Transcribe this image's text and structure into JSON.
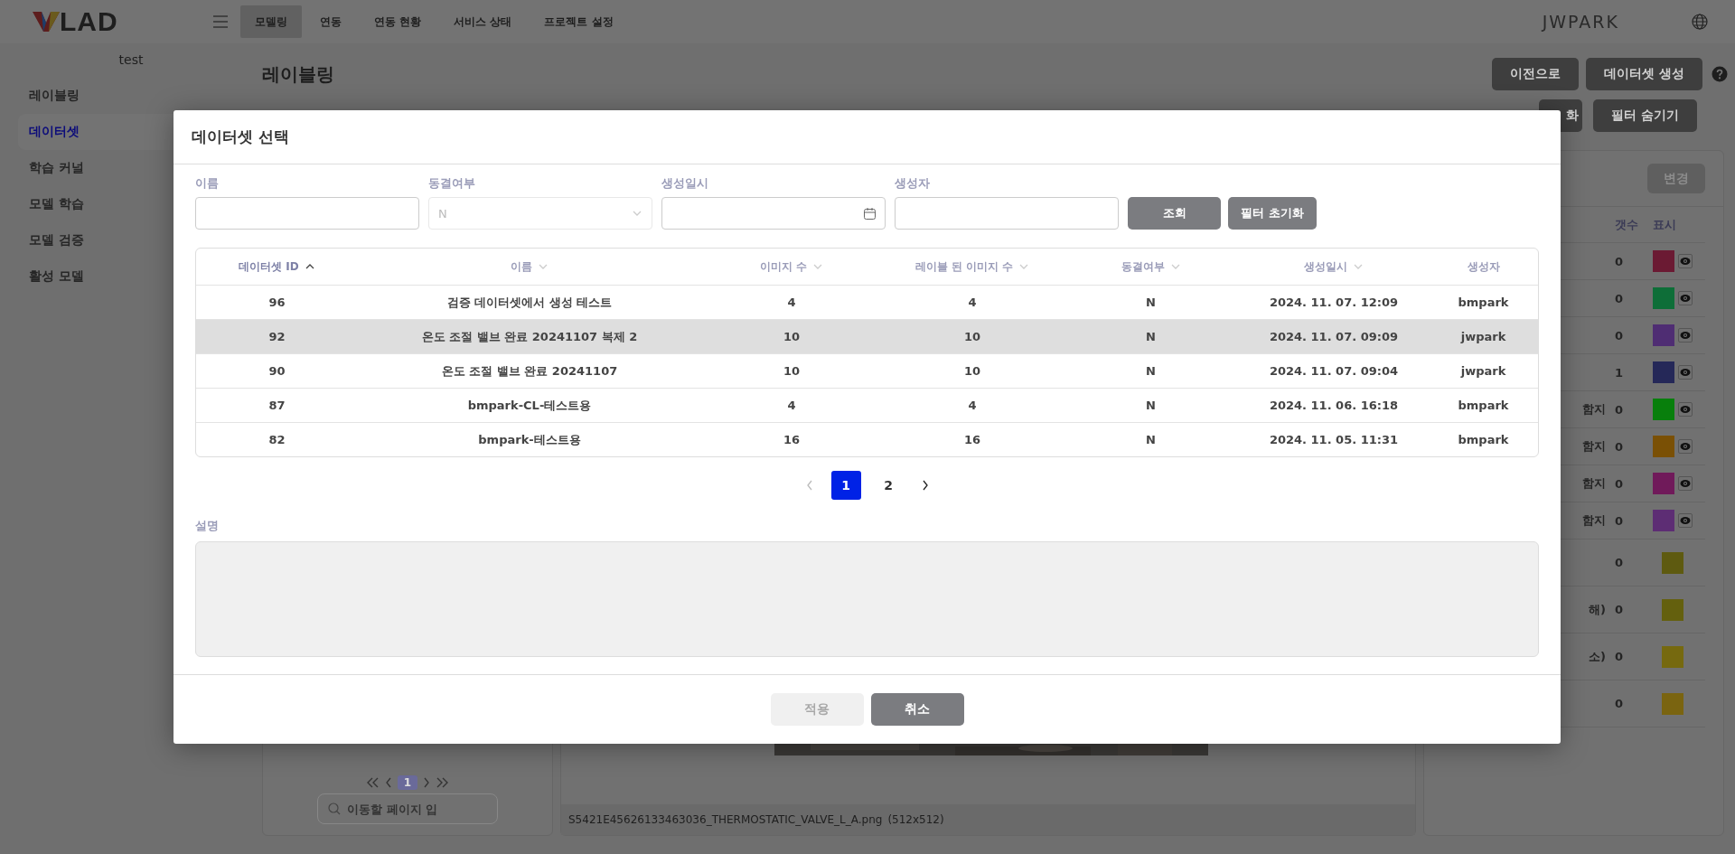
{
  "header": {
    "logo_text": "LAD",
    "nav": [
      {
        "label": "모델링",
        "selected": true
      },
      {
        "label": "연동",
        "selected": false
      },
      {
        "label": "연동 현황",
        "selected": false
      },
      {
        "label": "서비스 상태",
        "selected": false
      },
      {
        "label": "프로젝트 설정",
        "selected": false
      }
    ],
    "user": "JWPARK"
  },
  "sidebar": {
    "project": "test",
    "items": [
      {
        "label": "레이블링",
        "selected": false
      },
      {
        "label": "데이터셋",
        "selected": true
      },
      {
        "label": "학습 커널",
        "selected": false
      },
      {
        "label": "모델 학습",
        "selected": false
      },
      {
        "label": "모델 검증",
        "selected": false
      },
      {
        "label": "활성 모델",
        "selected": false
      }
    ]
  },
  "page": {
    "title": "레이블링",
    "actions": [
      "이전으로",
      "데이터셋 생성"
    ],
    "filter_actions": [
      "화",
      "필터 숨기기"
    ]
  },
  "labels_panel": {
    "button": "변경",
    "columns": [
      "갯수",
      "표시"
    ],
    "rows": [
      {
        "kind": "toggle",
        "count": "0",
        "color": "#6b1a33"
      },
      {
        "kind": "toggle",
        "count": "0",
        "color": "#0e6e38"
      },
      {
        "kind": "toggle",
        "count": "0",
        "color": "#4f2d73"
      },
      {
        "kind": "toggle",
        "count": "1",
        "color": "#252858"
      },
      {
        "kind": "toggle",
        "label": "함지",
        "count": "0",
        "color": "#087f0c"
      },
      {
        "kind": "toggle",
        "label": "함지",
        "count": "0",
        "color": "#7a5005"
      },
      {
        "kind": "toggle",
        "label": "함지",
        "count": "0",
        "color": "#701a5a"
      },
      {
        "kind": "toggle",
        "label": "함지",
        "count": "0",
        "color": "#5d2d74"
      },
      {
        "kind": "swatch",
        "count": "0",
        "color": "#5e5a10"
      },
      {
        "kind": "swatch",
        "label": "해)",
        "count": "0",
        "color": "#64600e"
      },
      {
        "kind": "swatch",
        "label": "소)",
        "count": "0",
        "color": "#76690f"
      },
      {
        "kind": "swatch",
        "count": "0",
        "color": "#7a6410"
      }
    ]
  },
  "thumb_pager": {
    "page": "1",
    "search_placeholder": "이동할 페이지 입"
  },
  "image_panel": {
    "filename": "S5421E45626133463036_THERMOSTATIC_VALVE_L_A.png",
    "size": "(512x512)"
  },
  "dialog": {
    "title": "데이터셋 선택",
    "filters": [
      {
        "label": "이름",
        "kind": "text"
      },
      {
        "label": "동결여부",
        "kind": "select",
        "value": "N",
        "disabled": true
      },
      {
        "label": "생성일시",
        "kind": "date"
      },
      {
        "label": "생성자",
        "kind": "text"
      }
    ],
    "filter_buttons": [
      "조회",
      "필터 초기화"
    ],
    "table": {
      "columns": [
        {
          "label": "데이터셋 ID",
          "sorted": true
        },
        {
          "label": "이름",
          "sorted": false
        },
        {
          "label": "이미지 수",
          "sorted": false
        },
        {
          "label": "레이블 된 이미지 수",
          "sorted": false
        },
        {
          "label": "동결여부",
          "sorted": false
        },
        {
          "label": "생성일시",
          "sorted": false
        },
        {
          "label": "생성자"
        }
      ],
      "rows": [
        {
          "selected": false,
          "cells": [
            "96",
            "검증 데이터셋에서 생성 테스트",
            "4",
            "4",
            "N",
            "2024. 11. 07. 12:09",
            "bmpark"
          ]
        },
        {
          "selected": true,
          "cells": [
            "92",
            "온도 조절 밸브 완료 20241107 복제 2",
            "10",
            "10",
            "N",
            "2024. 11. 07. 09:09",
            "jwpark"
          ]
        },
        {
          "selected": false,
          "cells": [
            "90",
            "온도 조절 밸브 완료 20241107",
            "10",
            "10",
            "N",
            "2024. 11. 07. 09:04",
            "jwpark"
          ]
        },
        {
          "selected": false,
          "cells": [
            "87",
            "bmpark-CL-테스트용",
            "4",
            "4",
            "N",
            "2024. 11. 06. 16:18",
            "bmpark"
          ]
        },
        {
          "selected": false,
          "cells": [
            "82",
            "bmpark-테스트용",
            "16",
            "16",
            "N",
            "2024. 11. 05. 11:31",
            "bmpark"
          ]
        }
      ]
    },
    "pagination": {
      "prev_disabled": true,
      "next_disabled": false,
      "pages": [
        {
          "label": "1",
          "selected": true
        },
        {
          "label": "2",
          "selected": false
        }
      ]
    },
    "description_label": "설명",
    "footer_buttons": [
      {
        "label": "적용",
        "disabled": true
      },
      {
        "label": "취소",
        "disabled": false
      }
    ]
  }
}
